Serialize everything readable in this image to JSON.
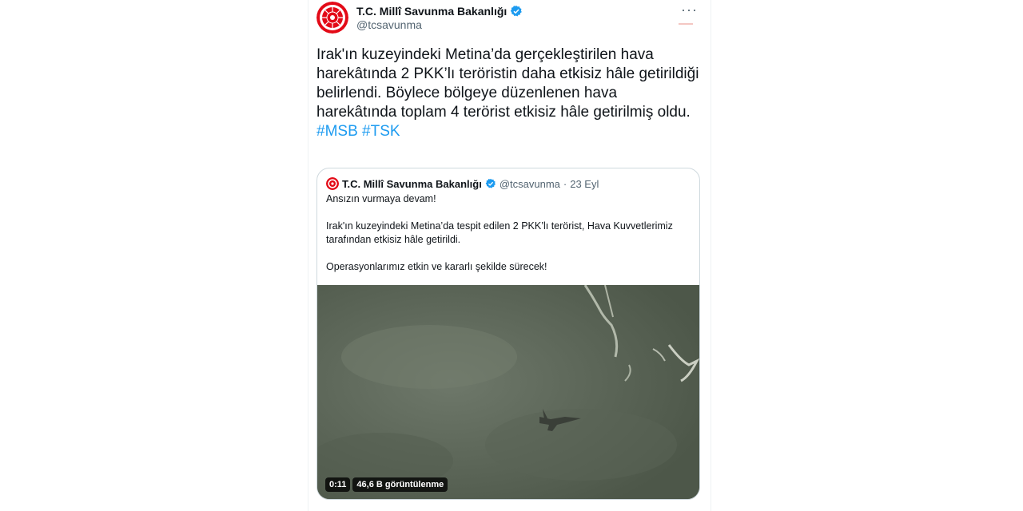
{
  "tweet": {
    "author_name": "T.C. Millî Savunma Bakanlığı",
    "author_handle": "@tcsavunma",
    "more_label": "···",
    "text": "Irak'ın kuzeyindeki Metina’da gerçekleştirilen hava harekâtında 2 PKK’lı teröristin daha etkisiz hâle getirildiği belirlendi. Böylece bölgeye düzenlenen hava harekâtında toplam 4 terörist etkisiz hâle getirilmiş oldu.",
    "hashtags": [
      "#MSB",
      "#TSK"
    ]
  },
  "quoted": {
    "author_name": "T.C. Millî Savunma Bakanlığı",
    "author_handle": "@tcsavunma",
    "separator": "·",
    "date": "23 Eyl",
    "paragraphs": [
      "Ansızın vurmaya devam!",
      "Irak'ın kuzeyindeki Metina’da tespit edilen 2 PKK’lı terörist, Hava Kuvvetlerimiz tarafından etkisiz hâle getirildi.",
      "Operasyonlarımız etkin ve kararlı şekilde sürecek!"
    ],
    "video": {
      "duration": "0:11",
      "views": "46,6 B görüntülenme"
    }
  },
  "colors": {
    "accent": "#1d9bf0",
    "emblem_red": "#e30a17",
    "text": "#0f1419",
    "muted": "#536471"
  }
}
